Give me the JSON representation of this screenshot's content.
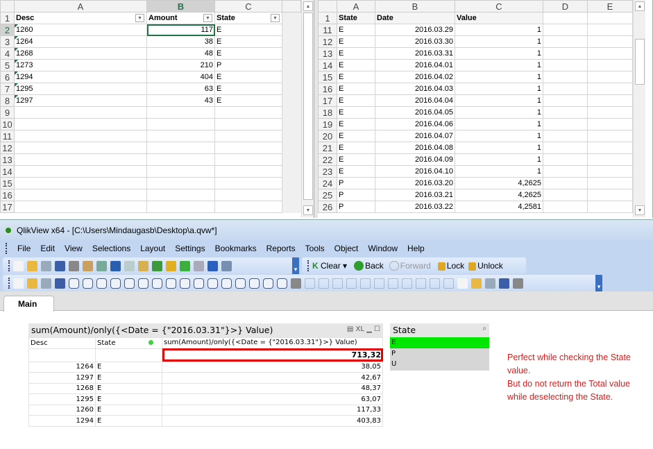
{
  "excel_left": {
    "columns": [
      "A",
      "B",
      "C"
    ],
    "headers": [
      "Desc",
      "Amount",
      "State"
    ],
    "rows": [
      [
        "1260",
        "117",
        "E"
      ],
      [
        "1264",
        "38",
        "E"
      ],
      [
        "1268",
        "48",
        "E"
      ],
      [
        "1273",
        "210",
        "P"
      ],
      [
        "1294",
        "404",
        "E"
      ],
      [
        "1295",
        "63",
        "E"
      ],
      [
        "1297",
        "43",
        "E"
      ]
    ],
    "row_numbers": [
      "1",
      "2",
      "3",
      "4",
      "5",
      "6",
      "7",
      "8",
      "9",
      "10",
      "11",
      "12",
      "13",
      "14",
      "15",
      "16",
      "17"
    ]
  },
  "excel_right": {
    "columns": [
      "A",
      "B",
      "C",
      "D",
      "E"
    ],
    "headers": [
      "State",
      "Date",
      "Value"
    ],
    "rows": [
      [
        "11",
        "E",
        "2016.03.29",
        "1"
      ],
      [
        "12",
        "E",
        "2016.03.30",
        "1"
      ],
      [
        "13",
        "E",
        "2016.03.31",
        "1"
      ],
      [
        "14",
        "E",
        "2016.04.01",
        "1"
      ],
      [
        "15",
        "E",
        "2016.04.02",
        "1"
      ],
      [
        "16",
        "E",
        "2016.04.03",
        "1"
      ],
      [
        "17",
        "E",
        "2016.04.04",
        "1"
      ],
      [
        "18",
        "E",
        "2016.04.05",
        "1"
      ],
      [
        "19",
        "E",
        "2016.04.06",
        "1"
      ],
      [
        "20",
        "E",
        "2016.04.07",
        "1"
      ],
      [
        "21",
        "E",
        "2016.04.08",
        "1"
      ],
      [
        "22",
        "E",
        "2016.04.09",
        "1"
      ],
      [
        "23",
        "E",
        "2016.04.10",
        "1"
      ],
      [
        "24",
        "P",
        "2016.03.20",
        "4,2625"
      ],
      [
        "25",
        "P",
        "2016.03.21",
        "4,2625"
      ],
      [
        "26",
        "P",
        "2016.03.22",
        "4,2581"
      ]
    ]
  },
  "qlikview": {
    "title": "QlikView x64 - [C:\\Users\\Mindaugasb\\Desktop\\a.qvw*]",
    "menu": [
      "File",
      "Edit",
      "View",
      "Selections",
      "Layout",
      "Settings",
      "Bookmarks",
      "Reports",
      "Tools",
      "Object",
      "Window",
      "Help"
    ],
    "toolbar1_icons": [
      "new-icon",
      "open-icon",
      "reload-icon",
      "save-icon",
      "print-icon",
      "edit-script-icon",
      "reload-data-icon",
      "undo-icon",
      "redo-icon",
      "search-icon",
      "properties-icon",
      "chart-wizard-icon",
      "bookmark-star-icon",
      "edit-icon",
      "help-icon",
      "whats-this-icon"
    ],
    "nav": {
      "clear": "Clear",
      "back": "Back",
      "forward": "Forward",
      "lock": "Lock",
      "unlock": "Unlock"
    },
    "toolbar2_icons": [
      "new-sheet-icon",
      "move-left-icon",
      "move-right-icon",
      "sheet-props-icon",
      "listbox-icon",
      "statistics-box-icon",
      "table-box-icon",
      "multibox-icon",
      "chart-icon",
      "input-box-icon",
      "current-selections-icon",
      "button-icon",
      "text-object-icon",
      "line-arrow-icon",
      "slider-icon",
      "bookmark-object-icon",
      "search-object-icon",
      "container-icon",
      "custom-object-icon",
      "quick-chart-icon",
      "format-painter-icon",
      "align-icon",
      "align-left-icon",
      "center-h-icon",
      "align-right-icon",
      "align-bottom-icon",
      "center-v-icon",
      "align-top-icon",
      "space-h-icon",
      "space-v-icon",
      "adjust-left-icon",
      "adjust-top-icon",
      "user-icon",
      "sheet-objects-icon",
      "notes-icon",
      "server-objects-icon",
      "web-view-icon"
    ],
    "tab": "Main",
    "chart": {
      "title": "sum(Amount)/only({<Date  =  {\"2016.03.31\"}>}  Value)",
      "columns": [
        "Desc",
        "State",
        "sum(Amount)/only({<Date = {\"2016.03.31\"}>} Value)"
      ],
      "total": "713,32",
      "rows": [
        [
          "1264",
          "E",
          "38,05"
        ],
        [
          "1297",
          "E",
          "42,67"
        ],
        [
          "1268",
          "E",
          "48,37"
        ],
        [
          "1295",
          "E",
          "63,07"
        ],
        [
          "1260",
          "E",
          "117,33"
        ],
        [
          "1294",
          "E",
          "403,83"
        ]
      ],
      "caption_icons": [
        "print-icon",
        "xl-export-icon",
        "minimize-icon",
        "maximize-icon"
      ]
    },
    "listbox": {
      "title": "State",
      "items": [
        "E",
        "P",
        "U"
      ],
      "selected": "E",
      "selected_color": "#00e600"
    },
    "note": [
      "Perfect while checking the State value.",
      "But do not return the Total value while deselecting the State."
    ],
    "note_color": "#d42020",
    "highlight_color": "#e00000"
  }
}
